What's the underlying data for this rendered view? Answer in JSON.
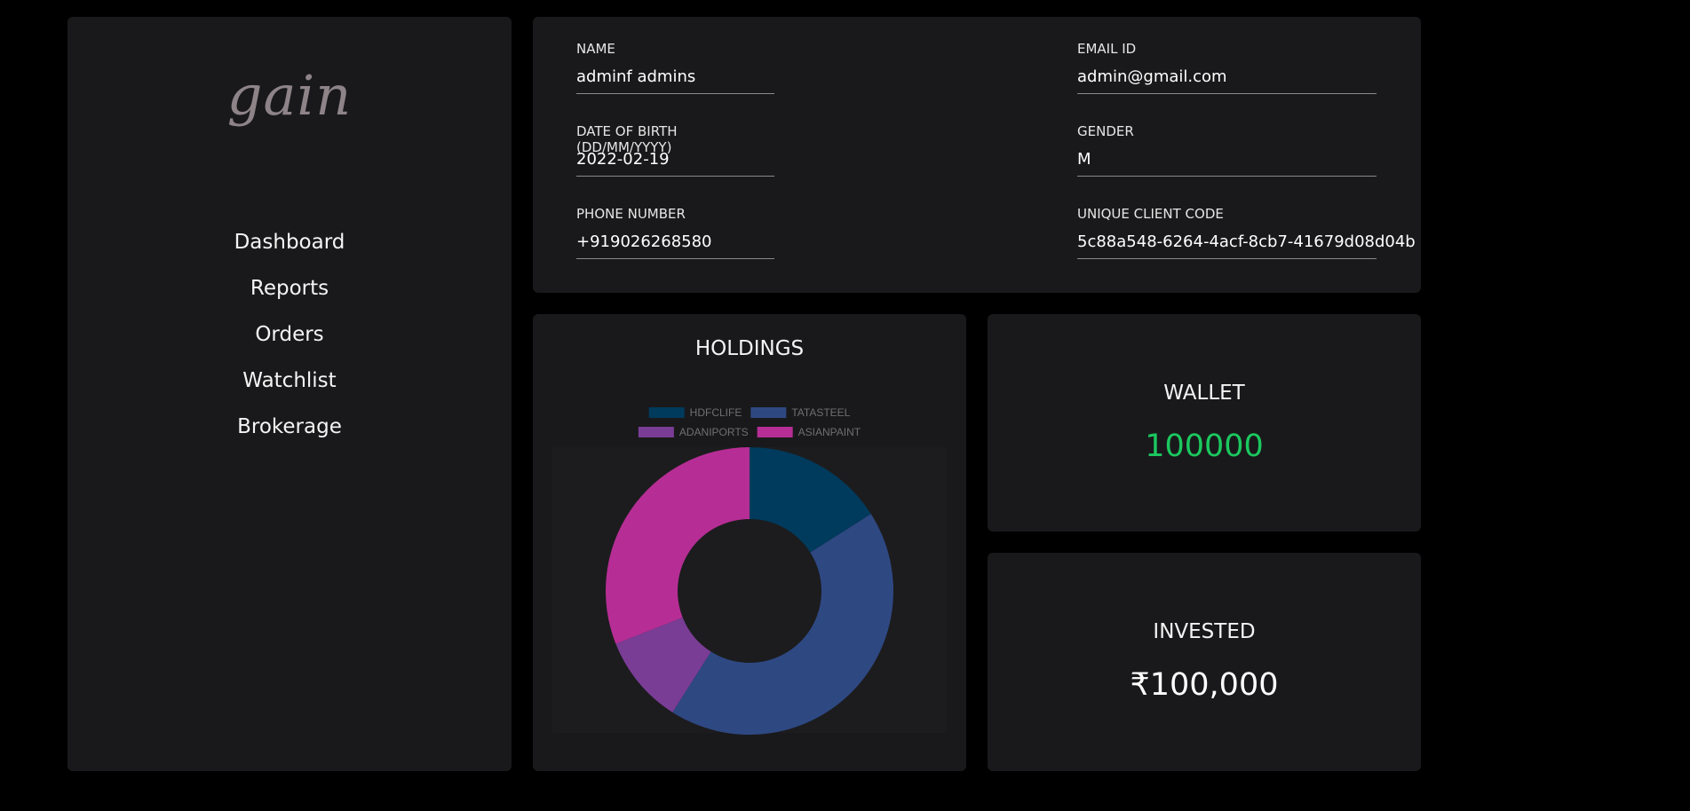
{
  "sidebar": {
    "logo": "gain",
    "nav": [
      "Dashboard",
      "Reports",
      "Orders",
      "Watchlist",
      "Brokerage"
    ]
  },
  "profile": {
    "name": {
      "label": "NAME",
      "value": "adminf admins"
    },
    "email": {
      "label": "EMAIL ID",
      "value": "admin@gmail.com"
    },
    "dob": {
      "label": "DATE OF BIRTH (DD/MM/YYYY)",
      "value": "2022-02-19"
    },
    "gender": {
      "label": "GENDER",
      "value": "M"
    },
    "phone": {
      "label": "PHONE NUMBER",
      "value": "+919026268580"
    },
    "ucc": {
      "label": "UNIQUE CLIENT CODE",
      "value": "5c88a548-6264-4acf-8cb7-41679d08d04b"
    }
  },
  "holdings": {
    "title": "HOLDINGS"
  },
  "wallet": {
    "title": "WALLET",
    "value": "100000",
    "color": "#1bc85f"
  },
  "invested": {
    "title": "INVESTED",
    "value": "₹100,000"
  },
  "chart_data": {
    "type": "pie",
    "title": "",
    "legend_position": "top",
    "categories": [
      "HDFCLIFE",
      "TATASTEEL",
      "ADANIPORTS",
      "ASIANPAINT"
    ],
    "values": [
      16,
      43,
      10,
      31
    ],
    "colors": [
      "#003a5c",
      "#2e4882",
      "#7a3d96",
      "#b62e95"
    ]
  }
}
